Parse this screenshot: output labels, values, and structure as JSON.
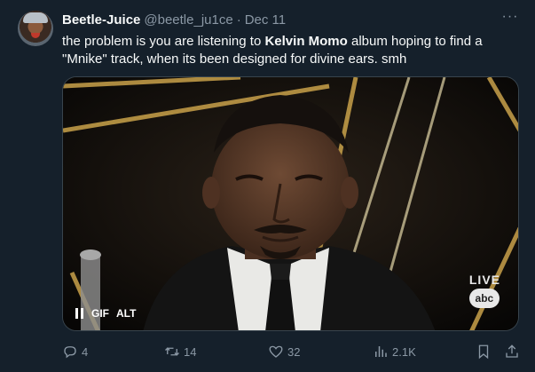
{
  "tweet": {
    "author_name": "Beetle-Juice",
    "handle": "@beetle_ju1ce",
    "separator": "·",
    "date": "Dec 11",
    "more_label": "···",
    "text_part1": "the problem is you are listening to ",
    "text_bold": "Kelvin Momo",
    "text_part2": " album hoping to find a \"Mnike\" track, when its been designed for divine ears. smh"
  },
  "media": {
    "gif_label": "GIF",
    "alt_label": "ALT",
    "live_label": "LIVE",
    "network_logo": "abc"
  },
  "actions": {
    "replies": "4",
    "retweets": "14",
    "likes": "32",
    "views": "2.1K"
  },
  "colors": {
    "background": "#15202b",
    "muted": "#8b98a5",
    "text": "#f7f9f9"
  },
  "icons": [
    "reply-icon",
    "retweet-icon",
    "like-icon",
    "views-icon",
    "bookmark-icon",
    "share-icon"
  ]
}
